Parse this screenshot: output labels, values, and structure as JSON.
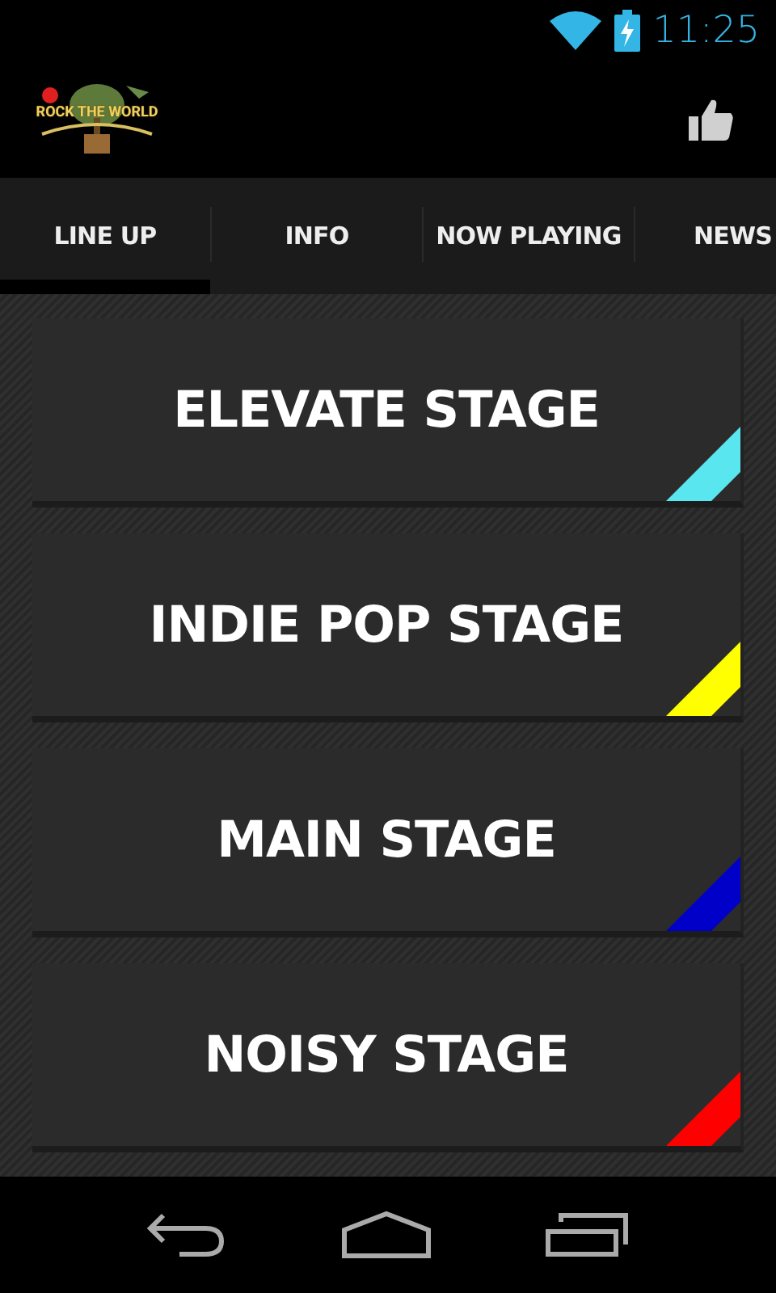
{
  "status_bar": {
    "time": "11:25"
  },
  "action_bar": {
    "logo_text": "ROCK THE WORLD"
  },
  "tabs": [
    {
      "label": "LINE UP",
      "selected": true
    },
    {
      "label": "INFO",
      "selected": false
    },
    {
      "label": "NOW PLAYING",
      "selected": false
    },
    {
      "label": "NEWS",
      "selected": false
    }
  ],
  "stages": [
    {
      "name": "ELEVATE STAGE",
      "color": "#5ae6ee"
    },
    {
      "name": "INDIE POP STAGE",
      "color": "#ffff00"
    },
    {
      "name": "MAIN STAGE",
      "color": "#0000c8"
    },
    {
      "name": "NOISY STAGE",
      "color": "#ff0000"
    }
  ]
}
